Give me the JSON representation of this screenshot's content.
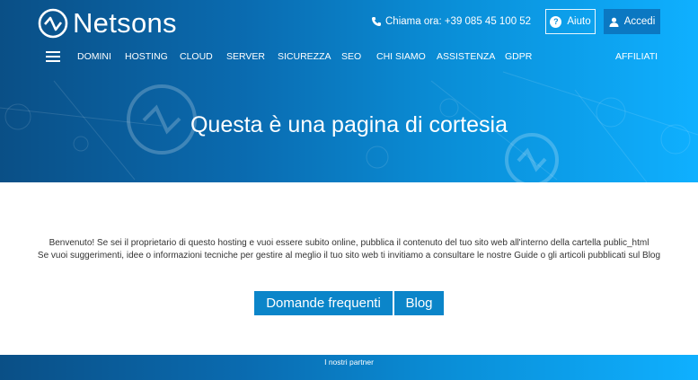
{
  "header": {
    "brand": "Netsons",
    "phone": "Chiama ora: +39 085 45 100 52",
    "help_label": "Aiuto",
    "login_label": "Accedi"
  },
  "nav": {
    "items": [
      "DOMINI",
      "HOSTING",
      "CLOUD",
      "SERVER",
      "SICUREZZA",
      "SEO",
      "CHI SIAMO",
      "ASSISTENZA",
      "GDPR"
    ],
    "affiliates": "AFFILIATI"
  },
  "hero": {
    "title": "Questa è una pagina di cortesia"
  },
  "content": {
    "line1": "Benvenuto! Se sei il proprietario di questo hosting e vuoi essere subito online, pubblica il contenuto del tuo sito web all'interno della cartella public_html",
    "line2": "Se vuoi suggerimenti, idee o informazioni tecniche per gestire al meglio il tuo sito web ti invitiamo a consultare le nostre Guide o gli articoli pubblicati sul Blog",
    "faq_button": "Domande frequenti",
    "blog_button": "Blog"
  },
  "footer": {
    "text": "I nostri partner"
  },
  "colors": {
    "brand_dark": "#0a4f86",
    "brand_light": "#0fb0ff",
    "button": "#0b85c9"
  }
}
